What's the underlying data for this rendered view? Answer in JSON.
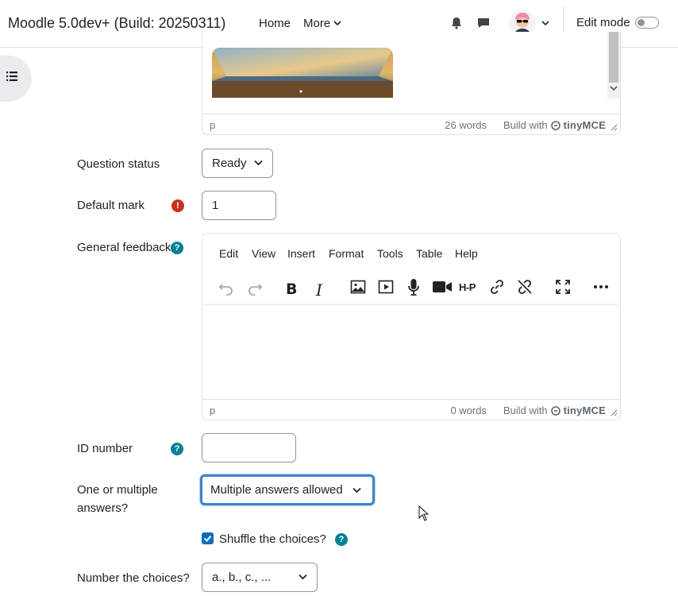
{
  "navbar": {
    "brand": "Moodle 5.0dev+ (Build: 20250311)",
    "home": "Home",
    "more": "More",
    "edit_mode": "Edit mode",
    "edit_mode_on": false
  },
  "question_text_editor": {
    "path": "p",
    "word_count": "26 words",
    "build_with": "Build with",
    "tiny_brand": "tinyMCE"
  },
  "question_status": {
    "label": "Question status",
    "value": "Ready"
  },
  "default_mark": {
    "label": "Default mark",
    "value": "1"
  },
  "general_feedback": {
    "label": "General feedback",
    "menus": [
      "Edit",
      "View",
      "Insert",
      "Format",
      "Tools",
      "Table",
      "Help"
    ],
    "toolbar_icons": [
      "undo-icon",
      "redo-icon",
      "bold-icon",
      "italic-icon",
      "image-icon",
      "media-icon",
      "microphone-icon",
      "video-camera-icon",
      "h5p-icon",
      "link-icon",
      "unlink-icon",
      "fullscreen-icon",
      "more-icon"
    ],
    "h5p_text": "H-P",
    "bold_text": "B",
    "italic_text": "I",
    "path": "p",
    "word_count": "0 words",
    "build_with": "Build with",
    "tiny_brand": "tinyMCE"
  },
  "id_number": {
    "label": "ID number",
    "value": ""
  },
  "single": {
    "label": "One or multiple answers?",
    "value": "Multiple answers allowed"
  },
  "shuffle": {
    "label": "Shuffle the choices?",
    "checked": true
  },
  "numbering": {
    "label": "Number the choices?",
    "value": "a., b., c., ..."
  },
  "colors": {
    "primary": "#0f6cbf",
    "required": "#ca3120",
    "help": "#008196",
    "focus": "#3f85c6"
  }
}
